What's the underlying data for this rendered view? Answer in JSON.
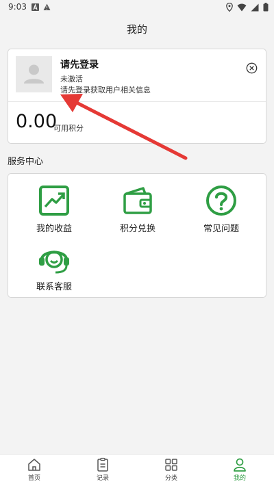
{
  "status_bar": {
    "time": "9:03"
  },
  "header": {
    "title": "我的"
  },
  "profile": {
    "login_prompt": "请先登录",
    "status": "未激活",
    "hint": "请先登录获取用户相关信息",
    "points_value": "0.00",
    "points_label": "可用积分"
  },
  "services": {
    "title": "服务中心",
    "items": [
      {
        "label": "我的收益",
        "icon": "earnings-chart-icon"
      },
      {
        "label": "积分兑换",
        "icon": "wallet-icon"
      },
      {
        "label": "常见问题",
        "icon": "question-icon"
      },
      {
        "label": "联系客服",
        "icon": "customer-service-icon"
      }
    ]
  },
  "bottom_nav": {
    "items": [
      {
        "label": "首页",
        "icon": "home-icon"
      },
      {
        "label": "记录",
        "icon": "record-icon"
      },
      {
        "label": "分类",
        "icon": "category-icon"
      },
      {
        "label": "我的",
        "icon": "user-icon",
        "active": true
      }
    ]
  },
  "colors": {
    "accent": "#2f9e44",
    "annotation_arrow": "#e53935",
    "background": "#f3f3f3"
  }
}
